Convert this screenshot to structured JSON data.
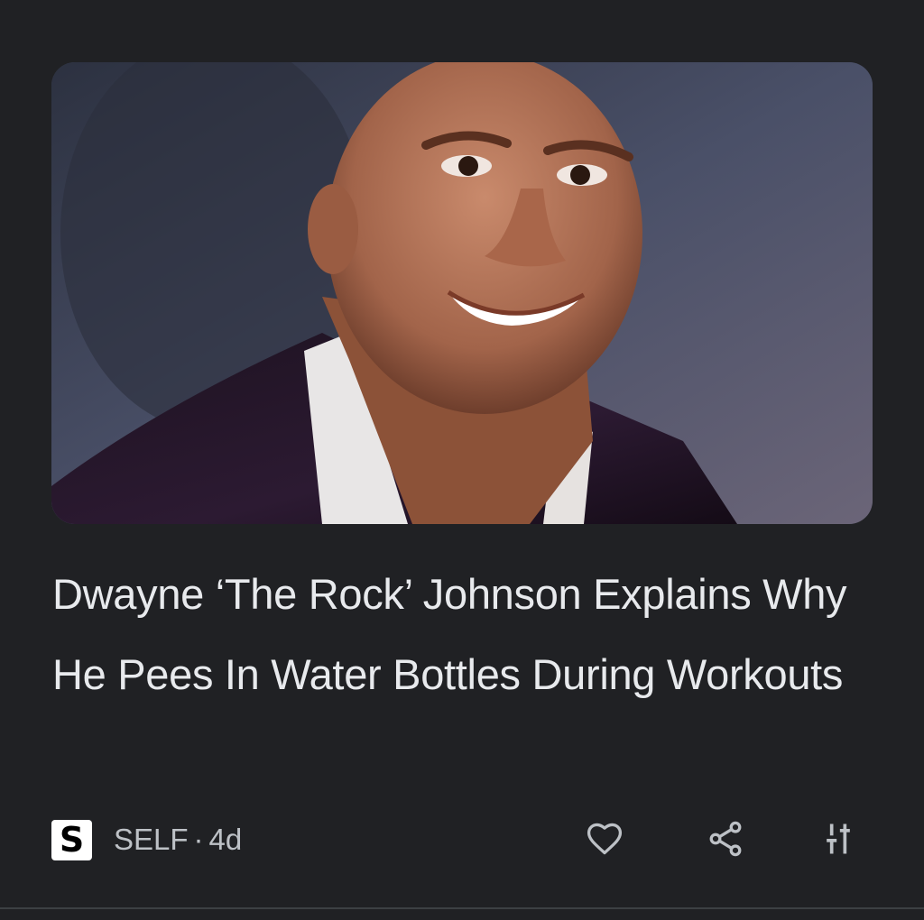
{
  "article": {
    "image_alt": "Dwayne Johnson smiling",
    "headline": "Dwayne ‘The Rock’ Johnson Explains Why He Pees In Water Bottles During Workouts",
    "publisher_logo": "S",
    "publisher": "SELF",
    "separator": "·",
    "age": "4d"
  },
  "actions": {
    "like_icon": "heart-outline-icon",
    "share_icon": "share-icon",
    "more_icon": "tune-icon"
  },
  "colors": {
    "background": "#202124",
    "headline_text": "#e8eaed",
    "meta_text": "#bdc1c6",
    "icon": "#bdc1c6"
  }
}
